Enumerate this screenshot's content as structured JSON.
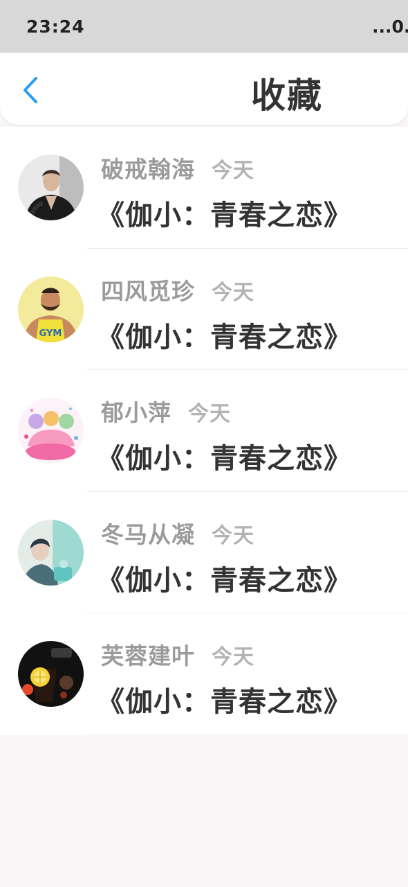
{
  "status_bar": {
    "time": "23:24",
    "right_text": "...0."
  },
  "header": {
    "back_icon": "chevron-left-icon",
    "title": "收藏"
  },
  "colors": {
    "accent": "#2a9df4",
    "title_text": "#333333",
    "name_text": "#9b9b9b",
    "time_text": "#b3b3b3"
  },
  "items": [
    {
      "name": "破戒翰海",
      "time": "今天",
      "title": "《伽小：青春之恋》",
      "avatar": "avatar-man-dark"
    },
    {
      "name": "四风觅珍",
      "time": "今天",
      "title": "《伽小：青春之恋》",
      "avatar": "avatar-gym-man"
    },
    {
      "name": "郁小萍",
      "time": "今天",
      "title": "《伽小：青春之恋》",
      "avatar": "avatar-anime-girls"
    },
    {
      "name": "冬马从凝",
      "time": "今天",
      "title": "《伽小：青春之恋》",
      "avatar": "avatar-teal-photo"
    },
    {
      "name": "芙蓉建叶",
      "time": "今天",
      "title": "《伽小：青春之恋》",
      "avatar": "avatar-lemon-drink"
    }
  ]
}
